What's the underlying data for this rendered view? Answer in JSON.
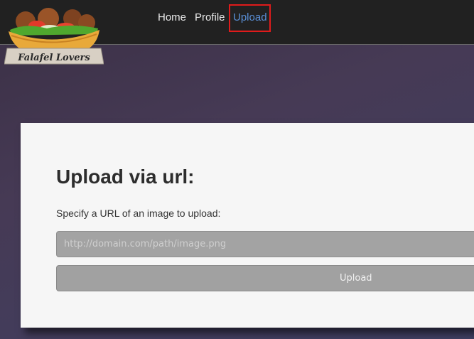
{
  "nav": {
    "home_label": "Home",
    "profile_label": "Profile",
    "upload_label": "Upload",
    "active_item": "Upload"
  },
  "logo": {
    "text": "Falafel Lovers"
  },
  "upload_form": {
    "title": "Upload via url:",
    "label": "Specify a URL of an image to upload:",
    "input_placeholder": "http://domain.com/path/image.png",
    "input_value": "",
    "button_label": "Upload"
  },
  "colors": {
    "navbar_bg": "#212121",
    "active_link": "#5a8fd6",
    "highlight_box": "#e01b1b",
    "card_bg": "#f6f6f6"
  }
}
